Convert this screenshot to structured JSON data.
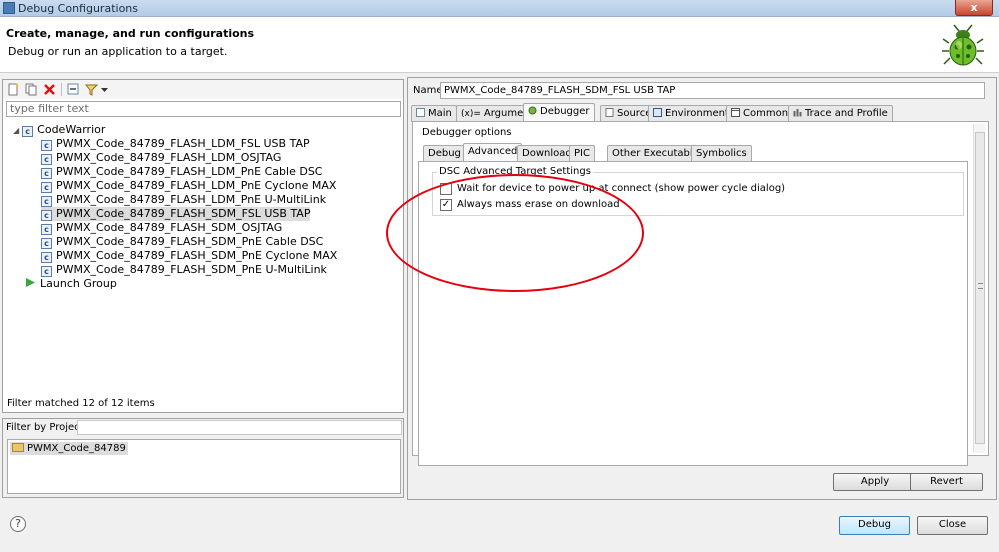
{
  "window": {
    "title": "Debug Configurations",
    "close": "x"
  },
  "header": {
    "title": "Create, manage, and run configurations",
    "subtitle": "Debug or run an application to a target."
  },
  "left": {
    "filter_placeholder": "type filter text",
    "root": "CodeWarrior",
    "items": [
      "PWMX_Code_84789_FLASH_LDM_FSL USB TAP",
      "PWMX_Code_84789_FLASH_LDM_OSJTAG",
      "PWMX_Code_84789_FLASH_LDM_PnE Cable DSC",
      "PWMX_Code_84789_FLASH_LDM_PnE Cyclone MAX",
      "PWMX_Code_84789_FLASH_LDM_PnE U-MultiLink",
      "PWMX_Code_84789_FLASH_SDM_FSL USB TAP",
      "PWMX_Code_84789_FLASH_SDM_OSJTAG",
      "PWMX_Code_84789_FLASH_SDM_PnE Cable DSC",
      "PWMX_Code_84789_FLASH_SDM_PnE Cyclone MAX",
      "PWMX_Code_84789_FLASH_SDM_PnE U-MultiLink"
    ],
    "launch_group": "Launch Group",
    "status": "Filter matched 12 of 12 items",
    "filter_by_project": "Filter by Project:",
    "project": "PWMX_Code_84789"
  },
  "right": {
    "name_label": "Name:",
    "name_value": "PWMX_Code_84789_FLASH_SDM_FSL USB TAP",
    "tabs": [
      "Main",
      "Arguments",
      "Debugger",
      "Source",
      "Environment",
      "Common",
      "Trace and Profile"
    ],
    "debugger_options": "Debugger options",
    "inner_tabs": [
      "Debug",
      "Advanced",
      "Download",
      "PIC",
      "Other Executables",
      "Symbolics"
    ],
    "group_title": "DSC Advanced Target Settings",
    "opt1": "Wait for device to power up at connect (show power cycle dialog)",
    "opt1_checked": false,
    "opt2": "Always mass erase on download",
    "opt2_checked": true,
    "checkmark": "✓",
    "apply": "Apply",
    "revert": "Revert"
  },
  "footer": {
    "help": "?",
    "debug": "Debug",
    "close": "Close"
  }
}
